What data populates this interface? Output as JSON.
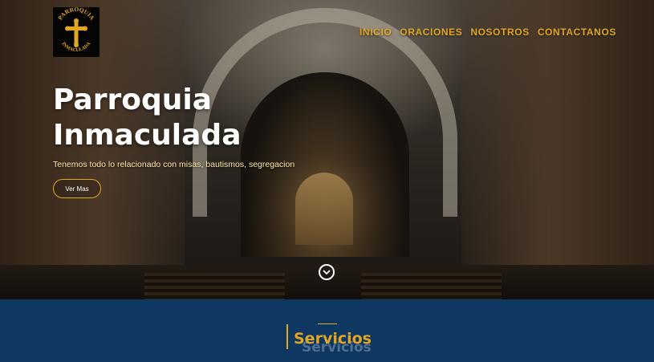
{
  "logo": {
    "text_top": "PARROQUIA",
    "text_bottom": "INMACULADA",
    "icon": "cross-icon"
  },
  "nav": {
    "items": [
      {
        "label": "INICIO"
      },
      {
        "label": "ORACIONES"
      },
      {
        "label": "NOSOTROS"
      },
      {
        "label": "CONTACTANOS"
      }
    ]
  },
  "hero": {
    "title_line1": "Parroquia",
    "title_line2": "Inmaculada",
    "subtitle": "Tenemos todo lo relacionado con misas, bautismos, segregacion",
    "cta_label": "Ver Mas",
    "scroll_icon": "chevron-down-circle-icon"
  },
  "services": {
    "title": "Servicios",
    "title_shadow": "Servicios"
  },
  "colors": {
    "accent": "#e2a624",
    "band": "#0e3862",
    "title_text": "#ffffff"
  }
}
